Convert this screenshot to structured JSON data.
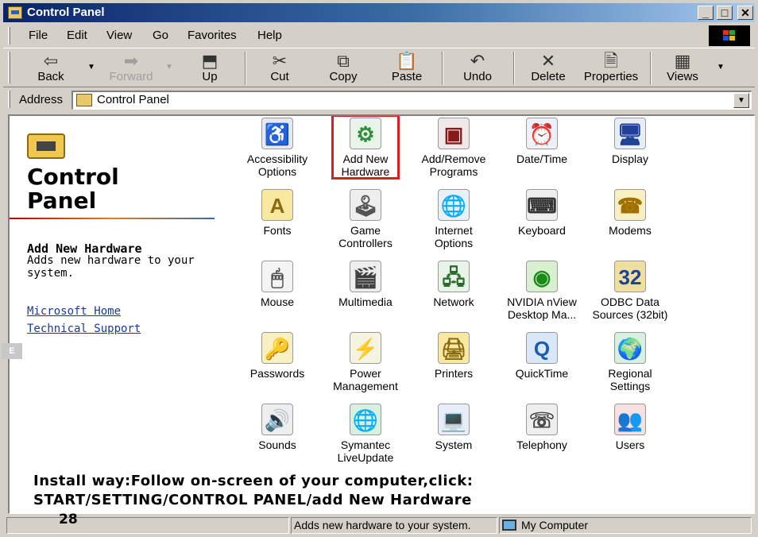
{
  "window": {
    "title": "Control Panel"
  },
  "titlebar": {
    "min": "_",
    "max": "□",
    "close": "✕"
  },
  "menu": [
    "File",
    "Edit",
    "View",
    "Go",
    "Favorites",
    "Help"
  ],
  "toolbar": {
    "back": "Back",
    "forward": "Forward",
    "up": "Up",
    "cut": "Cut",
    "copy": "Copy",
    "paste": "Paste",
    "undo": "Undo",
    "delete": "Delete",
    "properties": "Properties",
    "views": "Views"
  },
  "address": {
    "label": "Address",
    "value": "Control Panel"
  },
  "left_panel": {
    "title_line1": "Control",
    "title_line2": "Panel",
    "selected_name": "Add New Hardware",
    "selected_desc": "Adds new hardware to your system.",
    "link_home": "Microsoft Home",
    "link_support": "Technical Support"
  },
  "items": [
    {
      "l1": "Accessibility",
      "l2": "Options",
      "icon": "accessibility-icon"
    },
    {
      "l1": "Add New",
      "l2": "Hardware",
      "icon": "add-hardware-icon",
      "selected": true
    },
    {
      "l1": "Add/Remove",
      "l2": "Programs",
      "icon": "add-remove-programs-icon"
    },
    {
      "l1": "Date/Time",
      "l2": "",
      "icon": "date-time-icon"
    },
    {
      "l1": "Display",
      "l2": "",
      "icon": "display-icon"
    },
    {
      "l1": "Fonts",
      "l2": "",
      "icon": "fonts-icon"
    },
    {
      "l1": "Game",
      "l2": "Controllers",
      "icon": "game-controller-icon"
    },
    {
      "l1": "Internet",
      "l2": "Options",
      "icon": "internet-options-icon"
    },
    {
      "l1": "Keyboard",
      "l2": "",
      "icon": "keyboard-icon"
    },
    {
      "l1": "Modems",
      "l2": "",
      "icon": "modem-icon"
    },
    {
      "l1": "Mouse",
      "l2": "",
      "icon": "mouse-icon"
    },
    {
      "l1": "Multimedia",
      "l2": "",
      "icon": "multimedia-icon"
    },
    {
      "l1": "Network",
      "l2": "",
      "icon": "network-icon"
    },
    {
      "l1": "NVIDIA nView",
      "l2": "Desktop Ma...",
      "icon": "nvidia-icon"
    },
    {
      "l1": "ODBC Data",
      "l2": "Sources (32bit)",
      "icon": "odbc-icon"
    },
    {
      "l1": "Passwords",
      "l2": "",
      "icon": "keys-icon"
    },
    {
      "l1": "Power",
      "l2": "Management",
      "icon": "power-icon"
    },
    {
      "l1": "Printers",
      "l2": "",
      "icon": "printer-folder-icon"
    },
    {
      "l1": "QuickTime",
      "l2": "",
      "icon": "quicktime-icon"
    },
    {
      "l1": "Regional",
      "l2": "Settings",
      "icon": "globe-icon"
    },
    {
      "l1": "Sounds",
      "l2": "",
      "icon": "speaker-icon"
    },
    {
      "l1": "Symantec",
      "l2": "LiveUpdate",
      "icon": "liveupdate-icon"
    },
    {
      "l1": "System",
      "l2": "",
      "icon": "computer-icon"
    },
    {
      "l1": "Telephony",
      "l2": "",
      "icon": "telephony-icon"
    },
    {
      "l1": "Users",
      "l2": "",
      "icon": "users-icon"
    }
  ],
  "instruction": {
    "line1": "Install way:Follow on-screen of your computer,click:",
    "line2": "START/SETTING/CONTROL PANEL/add New Hardware"
  },
  "side_tab": "E",
  "status": {
    "pane1": "",
    "pane2": "Adds new hardware to your system.",
    "pane3": "My Computer"
  },
  "page_number": "28"
}
